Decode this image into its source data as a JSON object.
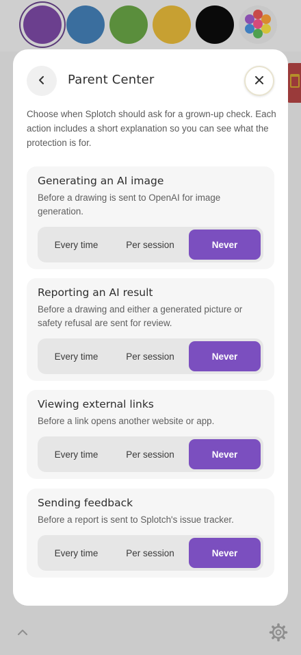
{
  "palette": {
    "colors": [
      "#6b3f8e",
      "#3a6e9e",
      "#5a8e3c",
      "#c7a032",
      "#0a0a0a"
    ],
    "selected_index": 0,
    "multi_colors": [
      "#c84a4a",
      "#d98a2f",
      "#d6c23a",
      "#4fa04f",
      "#3f7fc0",
      "#8a4fb0"
    ]
  },
  "modal": {
    "title": "Parent Center",
    "back_icon": "chevron-left-icon",
    "close_icon": "close-icon",
    "intro": "Choose when Splotch should ask for a grown-up check. Each action includes a short explanation so you can see what the protection is for."
  },
  "options": [
    "Every time",
    "Per session",
    "Never"
  ],
  "settings": [
    {
      "title": "Generating an AI image",
      "description": "Before a drawing is sent to OpenAI for image generation.",
      "selected": "Never"
    },
    {
      "title": "Reporting an AI result",
      "description": "Before a drawing and either a generated picture or safety refusal are sent for review.",
      "selected": "Never"
    },
    {
      "title": "Viewing external links",
      "description": "Before a link opens another website or app.",
      "selected": "Never"
    },
    {
      "title": "Sending feedback",
      "description": "Before a report is sent to Splotch's issue tracker.",
      "selected": "Never"
    }
  ],
  "colors": {
    "accent": "#7b4fbf",
    "card_bg": "#f6f6f6",
    "segment_bg": "#e6e6e6",
    "backdrop": "#cfcfcf"
  }
}
